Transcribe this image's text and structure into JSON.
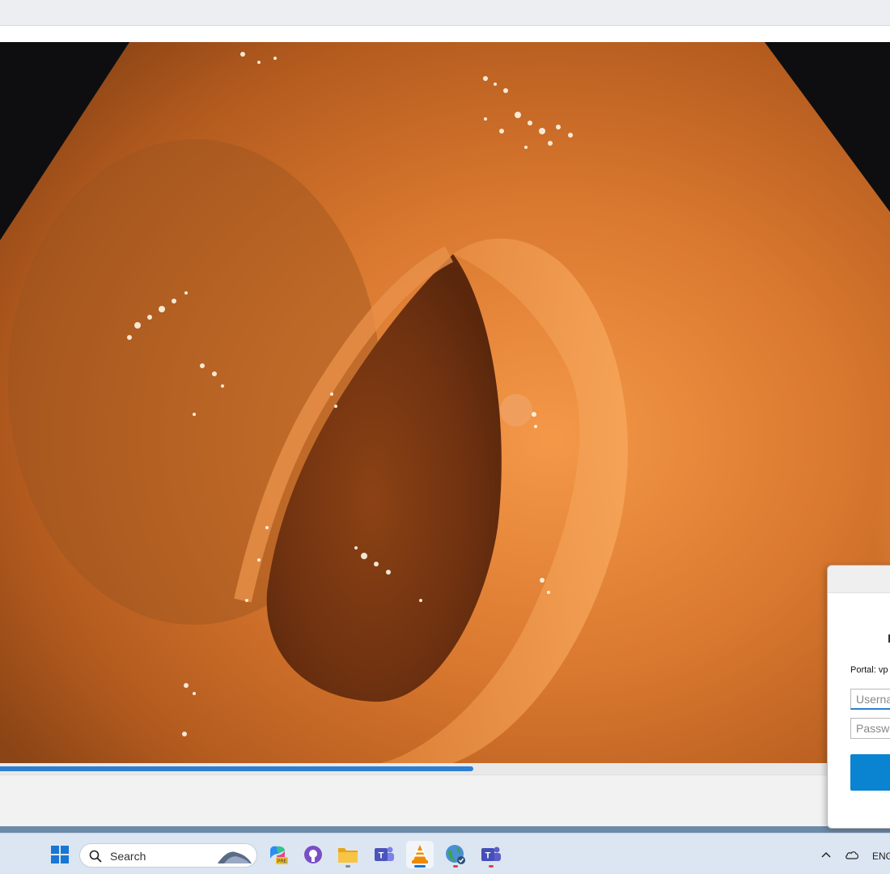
{
  "window": {
    "playback_progress_percent": 53.2
  },
  "video_frame": {
    "description_colors": {
      "background": "#0e0e10",
      "tissue_dark": "#7a3a12",
      "tissue_mid": "#c46a28",
      "tissue_light": "#f59848"
    }
  },
  "login_dialog": {
    "portal_label": "Portal: vp",
    "username_placeholder": "Userna",
    "password_placeholder": "Passwo",
    "accent_color": "#0a84d0"
  },
  "taskbar": {
    "search_placeholder": "Search",
    "apps": [
      {
        "icon": "windows-start-icon"
      },
      {
        "icon": "copilot-pre-icon"
      },
      {
        "icon": "github-icon"
      },
      {
        "icon": "file-explorer-icon"
      },
      {
        "icon": "teams-classic-icon"
      },
      {
        "icon": "vlc-icon",
        "active": true
      },
      {
        "icon": "browser-globe-icon"
      },
      {
        "icon": "teams-icon"
      }
    ],
    "tray": {
      "language": "ENG",
      "icons": [
        "chevron-up-icon",
        "cloud-icon"
      ]
    }
  }
}
